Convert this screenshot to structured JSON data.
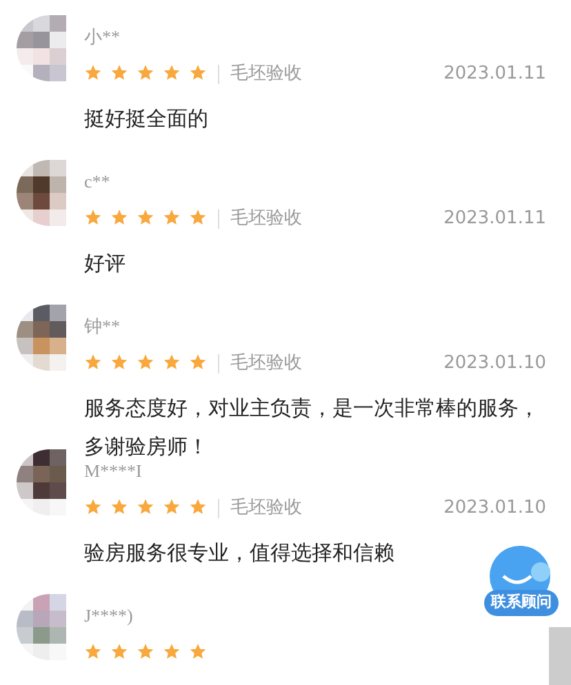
{
  "reviews": [
    {
      "name": "小**",
      "stars": 5,
      "tag": "毛坯验收",
      "date": "2023.01.11",
      "comment": "挺好挺全面的"
    },
    {
      "name": "c**",
      "stars": 5,
      "tag": "毛坯验收",
      "date": "2023.01.11",
      "comment": "好评"
    },
    {
      "name": "钟**",
      "stars": 5,
      "tag": "毛坯验收",
      "date": "2023.01.10",
      "comment": "服务态度好，对业主负责，是一次非常棒的服务，多谢验房师！"
    },
    {
      "name": "M****I",
      "stars": 5,
      "tag": "毛坯验收",
      "date": "2023.01.10",
      "comment": "验房服务很专业，值得选择和信赖"
    },
    {
      "name": "J****)",
      "stars": 5
    }
  ],
  "contact_button": {
    "label": "联系顾问"
  }
}
